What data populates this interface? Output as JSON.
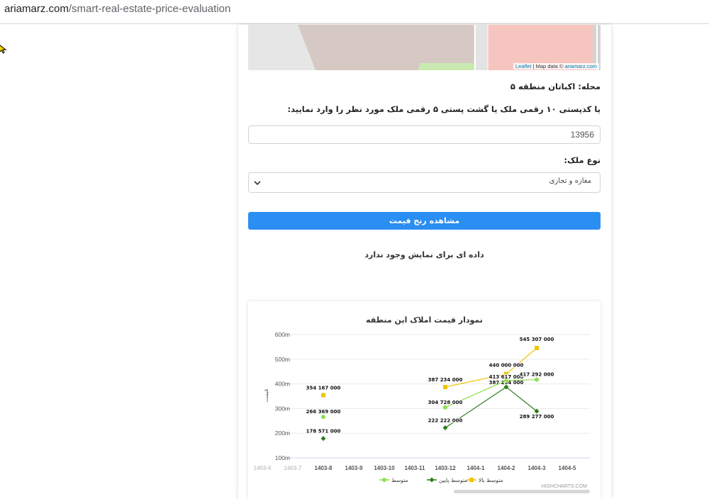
{
  "browser": {
    "url_host": "ariamarz.com",
    "url_path": "/smart-real-estate-price-evaluation"
  },
  "map": {
    "attribution_leaflet": "Leaflet",
    "attribution_sep": " | Map data © ",
    "attribution_source": "ariamarz.com"
  },
  "form": {
    "neighborhood_label": "محله: اکباتان منطقه ۵",
    "postal_prompt": "یا کدپستی ۱۰ رقمی ملک یا گشت پستی ۵ رقمی ملک مورد نظر را وارد نمایید:",
    "postal_value": "13956",
    "property_type_label": "نوع ملک:",
    "property_type_value": "مغازه و تجاری",
    "submit_label": "مشاهده رنج قیمت",
    "no_data_message": "داده ای برای نمایش وجود ندارد"
  },
  "chart_data": {
    "type": "line",
    "title": "نمودار قیمت املاک این منطقه",
    "ylabel": "قیمت",
    "ylim": [
      100000000,
      600000000
    ],
    "y_ticks": [
      "100m",
      "200m",
      "300m",
      "400m",
      "500m",
      "600m"
    ],
    "categories": [
      "1403-6",
      "1403-7",
      "1403-8",
      "1403-9",
      "1403-10",
      "1403-11",
      "1403-12",
      "1404-1",
      "1404-2",
      "1404-3",
      "1404-5"
    ],
    "categories_faded": [
      "1403-6",
      "1403-7"
    ],
    "credits": "HIGHCHARTS.COM",
    "series": [
      {
        "name": "متوسط بالا",
        "color": "#f0c400",
        "marker": "square",
        "points": [
          {
            "x": "1403-8",
            "y": 354167000,
            "label": "354 167 000"
          },
          {
            "x": "1403-12",
            "y": 387234000,
            "label": "387 234 000"
          },
          {
            "x": "1404-2",
            "y": 440000000,
            "label": "440 000 000"
          },
          {
            "x": "1404-3",
            "y": 545307000,
            "label": "545 307 000"
          }
        ]
      },
      {
        "name": "متوسط پایین",
        "color": "#2e7d1a",
        "marker": "diamond",
        "points": [
          {
            "x": "1403-8",
            "y": 178571000,
            "label": "178 571 000"
          },
          {
            "x": "1403-12",
            "y": 222222000,
            "label": "222 222 000"
          },
          {
            "x": "1404-2",
            "y": 387234000,
            "label": "387 234 000"
          },
          {
            "x": "1404-3",
            "y": 289277000,
            "label": "289 277 000"
          }
        ]
      },
      {
        "name": "متوسط",
        "color": "#8fe04a",
        "marker": "circle",
        "points": [
          {
            "x": "1403-8",
            "y": 266369000,
            "label": "266 369 000"
          },
          {
            "x": "1403-12",
            "y": 304728000,
            "label": "304 728 000"
          },
          {
            "x": "1404-2",
            "y": 413617000,
            "label": "413 617 000"
          },
          {
            "x": "1404-3",
            "y": 417292000,
            "label": "417 292 000"
          }
        ]
      }
    ]
  }
}
